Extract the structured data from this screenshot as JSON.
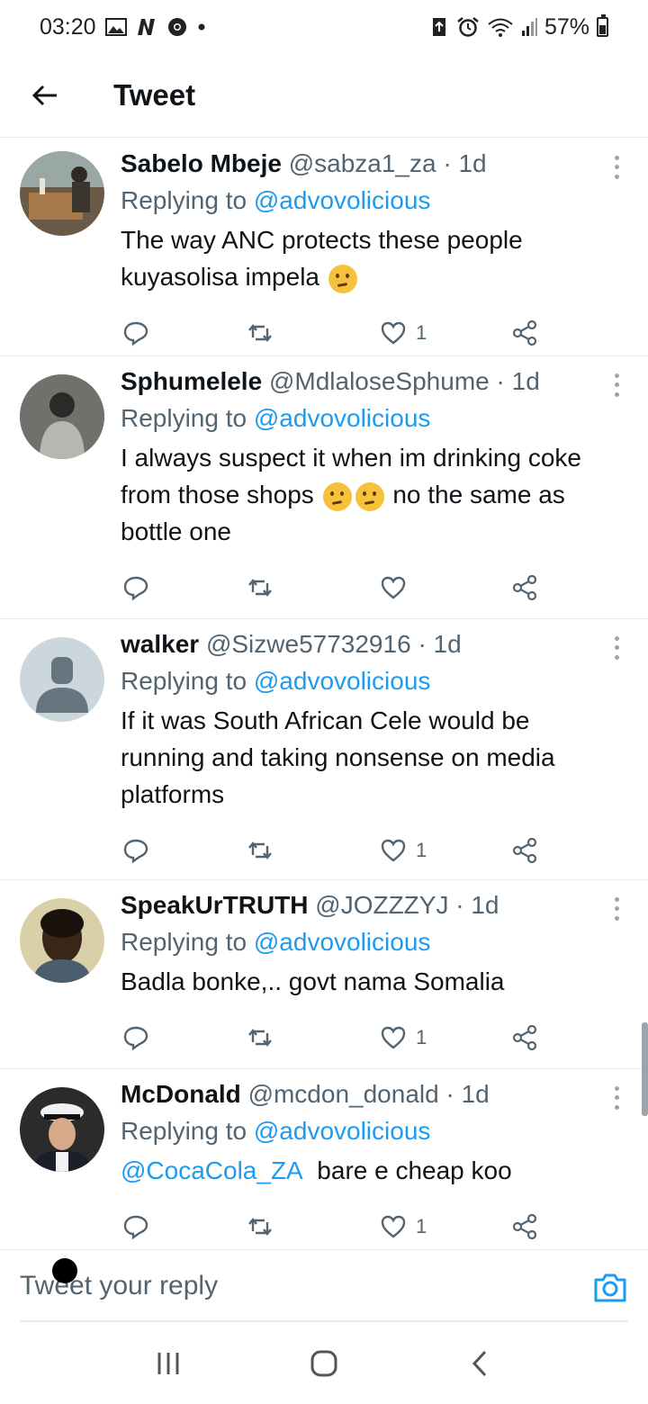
{
  "status_bar": {
    "time": "03:20",
    "battery": "57%",
    "icons_left": [
      "gallery-icon",
      "n-icon",
      "chrome-icon",
      "dot"
    ],
    "icons_right": [
      "data-saver-icon",
      "alarm-icon",
      "wifi-icon",
      "signal-icon",
      "battery-icon"
    ]
  },
  "header": {
    "title": "Tweet"
  },
  "tweets": [
    {
      "name": "Sabelo Mbeje",
      "handle": "@sabza1_za",
      "time": "· 1d",
      "replying_prefix": "Replying to ",
      "replying_to": "@advovolicious",
      "text_lines": [
        "The way ANC protects these people",
        "kuyasolisa impela"
      ],
      "likes": "1"
    },
    {
      "name": "Sphumelele",
      "handle": "@MdlaloseSphume",
      "time": "· 1d",
      "replying_prefix": "Replying to ",
      "replying_to": "@advovolicious",
      "text_lines": [
        "I always suspect it when im drinking coke",
        "from those shops",
        "no the same as",
        "bottle one"
      ],
      "likes": ""
    },
    {
      "name": "walker",
      "handle": "@Sizwe57732916",
      "time": "· 1d",
      "replying_prefix": "Replying to ",
      "replying_to": "@advovolicious",
      "text_lines": [
        "If it was South African Cele would be",
        "running and taking nonsense on media",
        "platforms"
      ],
      "likes": "1"
    },
    {
      "name": "SpeakUrTRUTH",
      "handle": "@JOZZZYJ",
      "time": "· 1d",
      "replying_prefix": "Replying to ",
      "replying_to": "@advovolicious",
      "text_lines": [
        "Badla bonke,.. govt nama Somalia"
      ],
      "likes": "1"
    },
    {
      "name": "McDonald",
      "handle": "@mcdon_donald",
      "time": "· 1d",
      "replying_prefix": "Replying to ",
      "replying_to": "@advovolicious",
      "mention": "@CocaCola_ZA",
      "text_lines": [
        "bare e cheap koo"
      ],
      "likes": "1"
    }
  ],
  "reply_bar": {
    "placeholder": "Tweet your reply"
  },
  "colors": {
    "link": "#1d9bf0",
    "secondary_text": "#536471",
    "divider": "#e6ecf0"
  }
}
